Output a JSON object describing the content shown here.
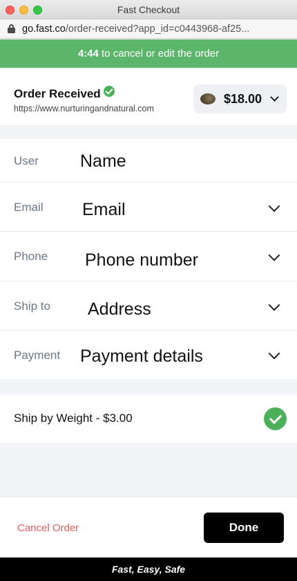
{
  "window": {
    "title": "Fast Checkout"
  },
  "address_bar": {
    "domain": "go.fast.co",
    "path": "/order-received?app_id=c0443968-af25..."
  },
  "timer_banner": {
    "countdown": "4:44",
    "message": " to cancel or edit the order"
  },
  "order": {
    "title": "Order Received",
    "store_url": "https://www.nurturingandnatural.com",
    "total": "$18.00"
  },
  "form": {
    "rows": [
      {
        "label": "User",
        "value": "Name"
      },
      {
        "label": "Email",
        "value": "Email"
      },
      {
        "label": "Phone",
        "value": "Phone number"
      },
      {
        "label": "Ship to",
        "value": "Address"
      },
      {
        "label": "Payment",
        "value": "Payment details"
      }
    ]
  },
  "shipping": {
    "label": "Ship by Weight - $3.00"
  },
  "actions": {
    "cancel_label": "Cancel Order",
    "done_label": "Done"
  },
  "footer": {
    "tagline": "Fast, Easy, Safe"
  },
  "colors": {
    "accent_green": "#5bb56b",
    "check_green": "#4caf5a",
    "cancel_red": "#e35d5d"
  }
}
